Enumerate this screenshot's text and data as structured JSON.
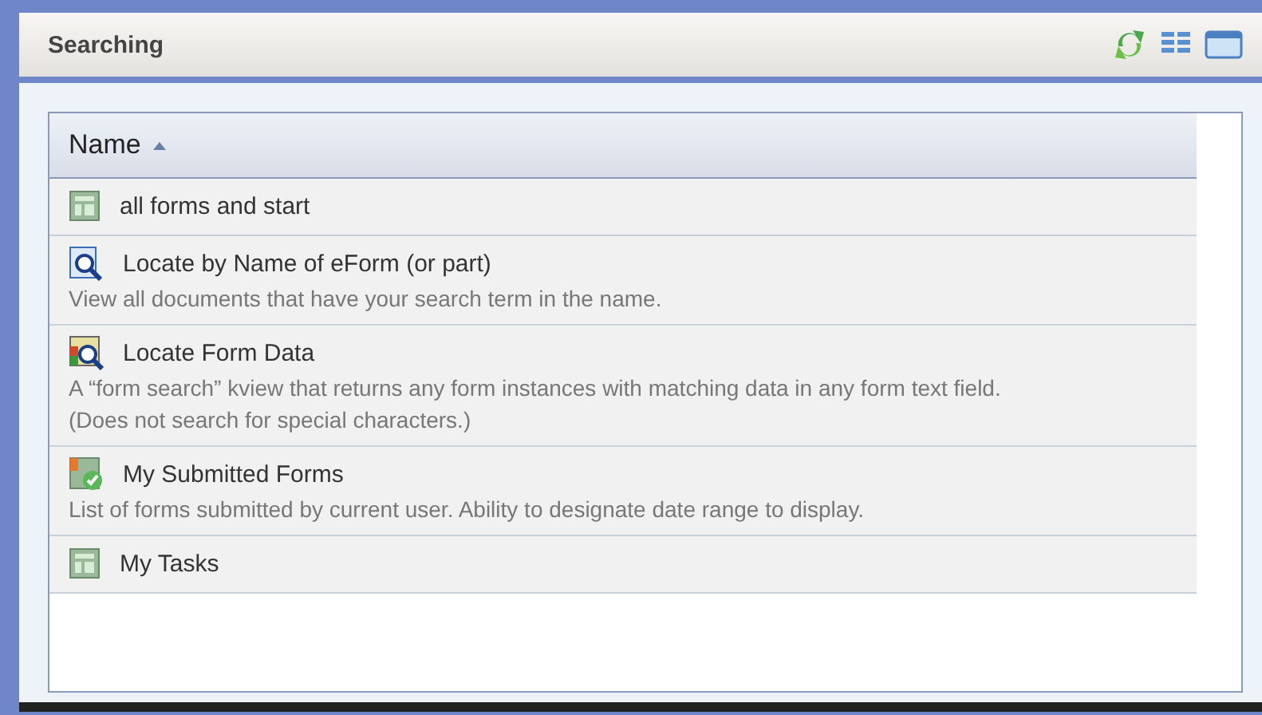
{
  "panel": {
    "title": "Searching"
  },
  "table": {
    "columns": [
      {
        "label": "Name",
        "sorted": true
      }
    ],
    "rows": [
      {
        "kind": "form",
        "title": "all forms and start"
      },
      {
        "kind": "search",
        "title": "Locate by Name of eForm (or part)",
        "description": [
          "View all documents that have your search term in the name."
        ]
      },
      {
        "kind": "data",
        "title": "Locate Form Data",
        "description": [
          "A “form search” kview that returns any form instances with matching data in any form text field.",
          "(Does not search for special characters.)"
        ]
      },
      {
        "kind": "submitted",
        "title": "My Submitted Forms",
        "description": [
          "List of forms submitted by current user. Ability to designate date range to display."
        ]
      },
      {
        "kind": "form",
        "title": "My Tasks"
      }
    ]
  }
}
